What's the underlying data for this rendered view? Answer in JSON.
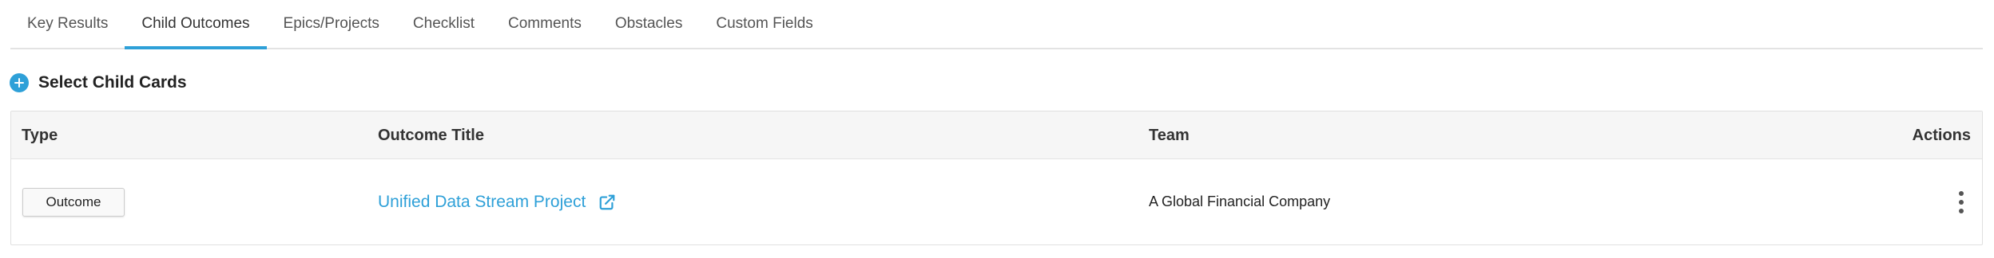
{
  "tabs": [
    {
      "label": "Key Results",
      "active": false
    },
    {
      "label": "Child Outcomes",
      "active": true
    },
    {
      "label": "Epics/Projects",
      "active": false
    },
    {
      "label": "Checklist",
      "active": false
    },
    {
      "label": "Comments",
      "active": false
    },
    {
      "label": "Obstacles",
      "active": false
    },
    {
      "label": "Custom Fields",
      "active": false
    }
  ],
  "select_child": {
    "label": "Select Child Cards",
    "icon": "plus-circle-icon"
  },
  "table": {
    "headers": {
      "type": "Type",
      "outcome_title": "Outcome Title",
      "team": "Team",
      "actions": "Actions"
    },
    "rows": [
      {
        "type": "Outcome",
        "outcome_title": "Unified Data Stream Project",
        "team": "A Global Financial Company",
        "link_icon": "external-link-icon",
        "actions_icon": "kebab-menu-icon"
      }
    ]
  },
  "colors": {
    "accent": "#2ea0d8",
    "header_bg": "#f6f6f6",
    "border": "#e0e0e0"
  }
}
